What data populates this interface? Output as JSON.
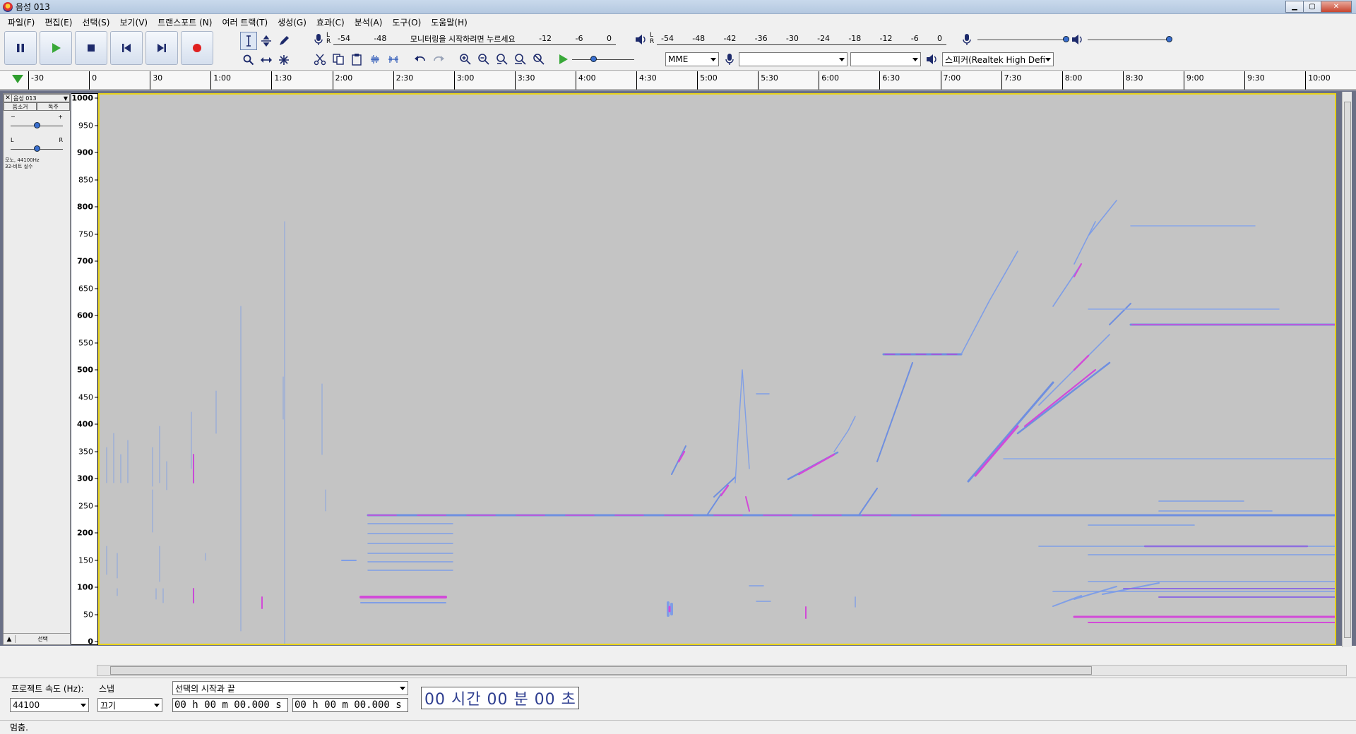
{
  "window": {
    "title": "음성 013"
  },
  "menu": [
    "파일(F)",
    "편집(E)",
    "선택(S)",
    "보기(V)",
    "트랜스포트 (N)",
    "여러 트랙(T)",
    "생성(G)",
    "효과(C)",
    "분석(A)",
    "도구(O)",
    "도움말(H)"
  ],
  "transport": [
    {
      "name": "pause-button",
      "icon": "pause-icon"
    },
    {
      "name": "play-button",
      "icon": "play-icon"
    },
    {
      "name": "stop-button",
      "icon": "stop-icon"
    },
    {
      "name": "skip-start-button",
      "icon": "skip-start-icon"
    },
    {
      "name": "skip-end-button",
      "icon": "skip-end-icon"
    },
    {
      "name": "record-button",
      "icon": "record-icon"
    }
  ],
  "record_meter": {
    "ticks": [
      "-54",
      "-48",
      "-12",
      "-6",
      "0"
    ],
    "prompt": "모니터링을 시작하려면 누르세요"
  },
  "play_meter": {
    "ticks": [
      "-54",
      "-48",
      "-42",
      "-36",
      "-30",
      "-24",
      "-18",
      "-12",
      "-6",
      "0"
    ]
  },
  "meter_lr": {
    "l": "L",
    "r": "R"
  },
  "devices": {
    "host": "MME",
    "record_device": "",
    "channels": "",
    "playback_device": "스피커(Realtek High Defi"
  },
  "ruler": {
    "ticks": [
      "-30",
      "0",
      "30",
      "1:00",
      "1:30",
      "2:00",
      "2:30",
      "3:00",
      "3:30",
      "4:00",
      "4:30",
      "5:00",
      "5:30",
      "6:00",
      "6:30",
      "7:00",
      "7:30",
      "8:00",
      "8:30",
      "9:00",
      "9:30",
      "10:00"
    ]
  },
  "track": {
    "name": "음성 013",
    "mute": "음소거",
    "solo": "독주",
    "gain_minus": "−",
    "gain_plus": "+",
    "pan_l": "L",
    "pan_r": "R",
    "info_line1": "모노, 44100Hz",
    "info_line2": "32-비트 실수",
    "select_label": "선택"
  },
  "freq_axis": {
    "ticks": [
      "1000",
      "950",
      "900",
      "850",
      "800",
      "750",
      "700",
      "650",
      "600",
      "550",
      "500",
      "450",
      "400",
      "350",
      "300",
      "250",
      "200",
      "150",
      "100",
      "50",
      "0"
    ]
  },
  "selection_toolbar": {
    "rate_label": "프로젝트 속도 (Hz):",
    "rate_value": "44100",
    "snap_label": "스냅",
    "snap_value": "끄기",
    "selection_mode": "선택의 시작과 끝",
    "start_time": "00 h 00 m 00.000 s",
    "end_time": "00 h 00 m 00.000 s",
    "audio_position": "00 시간 00 분 00 초"
  },
  "status": {
    "text": "멈춤."
  },
  "colors": {
    "accent_blue": "#3a6fd0",
    "spectro_bg": "#c4c4c4",
    "selection_border": "#e7d21a",
    "play_green": "#2f9e2f",
    "record_red": "#e02020"
  }
}
